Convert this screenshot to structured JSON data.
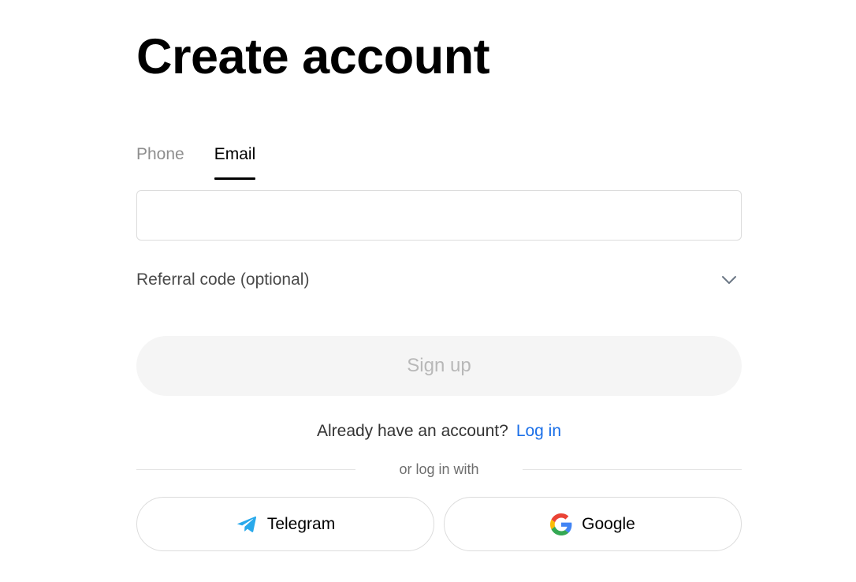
{
  "header": {
    "title": "Create account"
  },
  "tabs": [
    {
      "label": "Phone",
      "active": false
    },
    {
      "label": "Email",
      "active": true
    }
  ],
  "email_input": {
    "value": "",
    "placeholder": ""
  },
  "referral": {
    "label": "Referral code (optional)",
    "icon": "chevron-down-icon"
  },
  "signup": {
    "label": "Sign up",
    "enabled": false
  },
  "login_prompt": {
    "text": "Already have an account?",
    "link_label": "Log in",
    "link_color": "#1a6fe8"
  },
  "divider": {
    "text": "or log in with"
  },
  "social_buttons": [
    {
      "label": "Telegram",
      "icon": "telegram-icon",
      "icon_color": "#29a9eb"
    },
    {
      "label": "Google",
      "icon": "google-icon"
    }
  ]
}
